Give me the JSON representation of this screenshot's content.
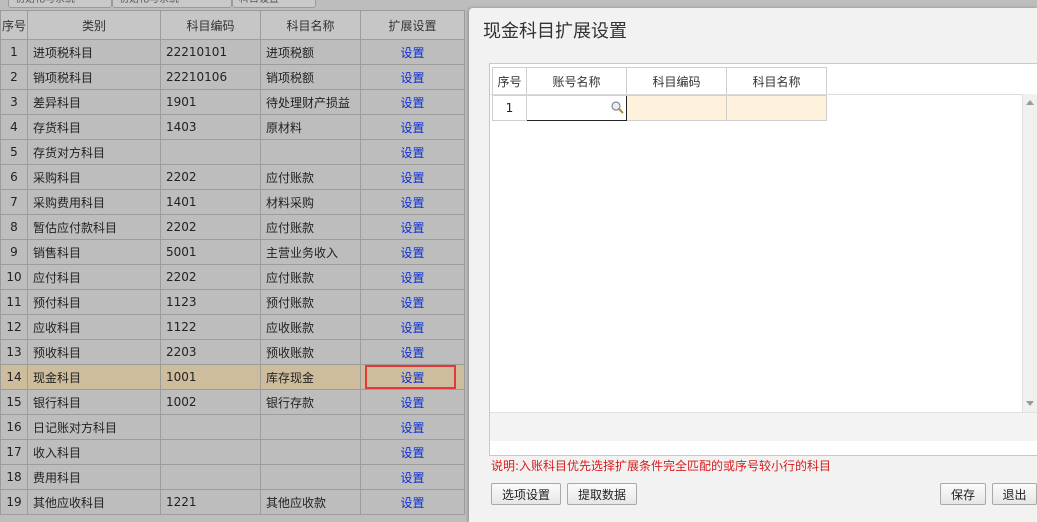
{
  "left_tabs": [
    "初始化与系统",
    "初始化与系统",
    "科目设置"
  ],
  "grid": {
    "columns": [
      "序号",
      "类别",
      "科目编码",
      "科目名称",
      "扩展设置"
    ],
    "rows": [
      {
        "no": "1",
        "category": "进项税科目",
        "code": "22210101",
        "name": "进项税额",
        "action": "设置"
      },
      {
        "no": "2",
        "category": "销项税科目",
        "code": "22210106",
        "name": "销项税额",
        "action": "设置"
      },
      {
        "no": "3",
        "category": "差异科目",
        "code": "1901",
        "name": "待处理财产损益",
        "action": "设置"
      },
      {
        "no": "4",
        "category": "存货科目",
        "code": "1403",
        "name": "原材料",
        "action": "设置"
      },
      {
        "no": "5",
        "category": "存货对方科目",
        "code": "",
        "name": "",
        "action": "设置"
      },
      {
        "no": "6",
        "category": "采购科目",
        "code": "2202",
        "name": "应付账款",
        "action": "设置"
      },
      {
        "no": "7",
        "category": "采购费用科目",
        "code": "1401",
        "name": "材料采购",
        "action": "设置"
      },
      {
        "no": "8",
        "category": "暂估应付款科目",
        "code": "2202",
        "name": "应付账款",
        "action": "设置"
      },
      {
        "no": "9",
        "category": "销售科目",
        "code": "5001",
        "name": "主营业务收入",
        "action": "设置"
      },
      {
        "no": "10",
        "category": "应付科目",
        "code": "2202",
        "name": "应付账款",
        "action": "设置"
      },
      {
        "no": "11",
        "category": "预付科目",
        "code": "1123",
        "name": "预付账款",
        "action": "设置"
      },
      {
        "no": "12",
        "category": "应收科目",
        "code": "1122",
        "name": "应收账款",
        "action": "设置"
      },
      {
        "no": "13",
        "category": "预收科目",
        "code": "2203",
        "name": "预收账款",
        "action": "设置"
      },
      {
        "no": "14",
        "category": "现金科目",
        "code": "1001",
        "name": "库存现金",
        "action": "设置"
      },
      {
        "no": "15",
        "category": "银行科目",
        "code": "1002",
        "name": "银行存款",
        "action": "设置"
      },
      {
        "no": "16",
        "category": "日记账对方科目",
        "code": "",
        "name": "",
        "action": "设置"
      },
      {
        "no": "17",
        "category": "收入科目",
        "code": "",
        "name": "",
        "action": "设置"
      },
      {
        "no": "18",
        "category": "费用科目",
        "code": "",
        "name": "",
        "action": "设置"
      },
      {
        "no": "19",
        "category": "其他应收科目",
        "code": "1221",
        "name": "其他应收款",
        "action": "设置"
      }
    ],
    "selected_row": "14"
  },
  "dialog": {
    "title": "现金科目扩展设置",
    "columns": [
      "序号",
      "账号名称",
      "科目编码",
      "科目名称"
    ],
    "row": {
      "no": "1",
      "account_name": "",
      "subject_code": "",
      "subject_name": ""
    },
    "note": "说明:入账科目优先选择扩展条件完全匹配的或序号较小行的科目",
    "buttons": {
      "options": "选项设置",
      "fetch": "提取数据",
      "save": "保存",
      "exit": "退出"
    }
  },
  "colors": {
    "highlight_border": "#e23a3a",
    "link": "#0b2fd8",
    "note": "#d81c1c",
    "selected_row": "#cdbd9d",
    "empty_cell": "#fff2dc"
  }
}
